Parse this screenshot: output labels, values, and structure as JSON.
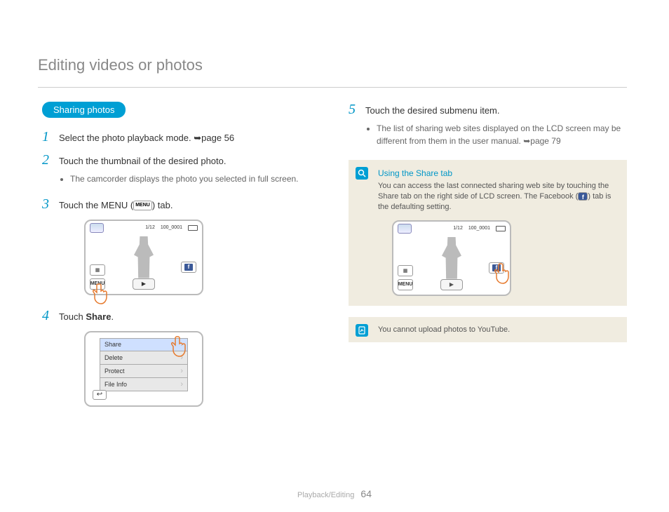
{
  "page_title": "Editing videos or photos",
  "section_pill": "Sharing photos",
  "steps": {
    "s1": {
      "num": "1",
      "text": "Select the photo playback mode. ",
      "ref": "page 56"
    },
    "s2": {
      "num": "2",
      "text": "Touch the thumbnail of the desired photo.",
      "bullet": "The camcorder displays the photo you selected in full screen."
    },
    "s3": {
      "num": "3",
      "pre": "Touch the MENU (",
      "chip": "MENU",
      "post": ") tab."
    },
    "s4": {
      "num": "4",
      "pre": "Touch ",
      "strong": "Share",
      "post": "."
    },
    "s5": {
      "num": "5",
      "text": "Touch the desired submenu item.",
      "bullet_pre": "The list of sharing web sites displayed on the LCD screen may be different from them in the user manual. ",
      "bullet_ref": "page 79"
    }
  },
  "camera_status": {
    "count": "1/12",
    "file": "100_0001"
  },
  "menu_items": {
    "share": "Share",
    "delete": "Delete",
    "protect": "Protect",
    "fileinfo": "File Info"
  },
  "info": {
    "title": "Using the Share tab",
    "body_pre": "You can access the last connected sharing web site by touching the Share tab on the right side of LCD screen. The Facebook (",
    "body_post": ") tab is the defaulting setting."
  },
  "note": {
    "text": "You cannot upload photos to YouTube."
  },
  "footer": {
    "section": "Playback/Editing",
    "page": "64"
  }
}
